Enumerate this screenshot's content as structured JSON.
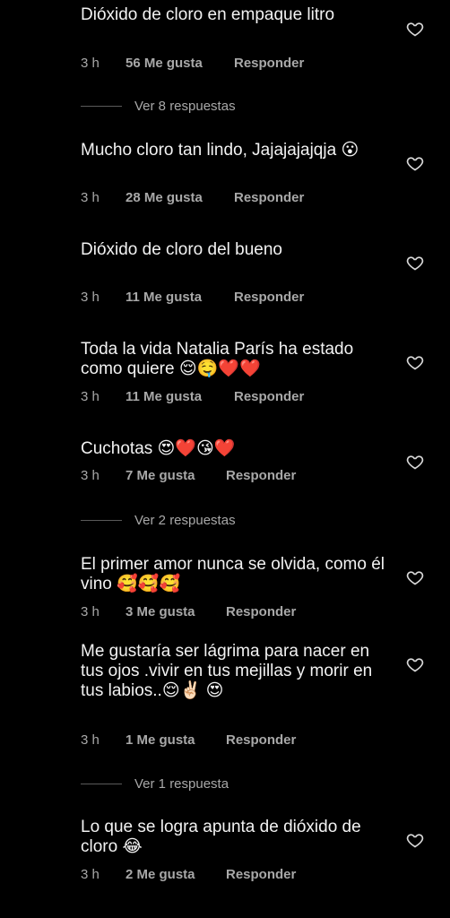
{
  "comments": [
    {
      "text": "Dióxido de cloro en empaque litro",
      "time": "3 h",
      "likes": "56 Me gusta",
      "reply": "Responder",
      "replies": "Ver 8 respuestas"
    },
    {
      "text": "Mucho cloro tan lindo, Jajajajajqja 😮",
      "time": "3 h",
      "likes": "28 Me gusta",
      "reply": "Responder"
    },
    {
      "text": "Dióxido de cloro del bueno",
      "time": "3 h",
      "likes": "11 Me gusta",
      "reply": "Responder"
    },
    {
      "text": "Toda la vida Natalia París ha estado como quiere 😌🤤❤️❤️",
      "time": "3 h",
      "likes": "11 Me gusta",
      "reply": "Responder"
    },
    {
      "text": "Cuchotas 😍❤️😘❤️",
      "time": "3 h",
      "likes": "7 Me gusta",
      "reply": "Responder",
      "replies": "Ver 2 respuestas"
    },
    {
      "text": "El primer amor nunca se olvida, como él vino 🥰🥰🥰",
      "time": "3 h",
      "likes": "3 Me gusta",
      "reply": "Responder"
    },
    {
      "text": "Me gustaría ser lágrima para nacer en tus ojos .vivir en tus mejillas y morir en tus labios..😌✌🏻 😍",
      "time": "3 h",
      "likes": "1 Me gusta",
      "reply": "Responder",
      "replies": "Ver 1 respuesta"
    },
    {
      "text": "Lo que se logra apunta de dióxido de cloro 😂",
      "time": "3 h",
      "likes": "2 Me gusta",
      "reply": "Responder"
    }
  ],
  "icons": {
    "like": "heart-outline-icon"
  }
}
